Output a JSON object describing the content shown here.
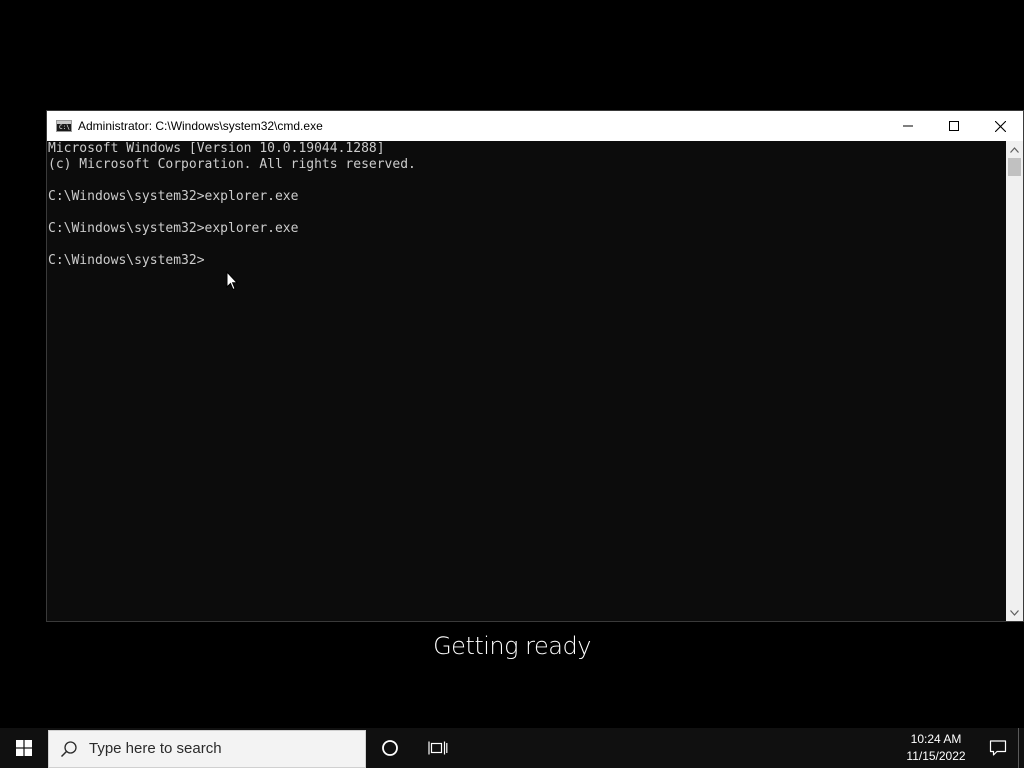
{
  "window": {
    "title": "Administrator: C:\\Windows\\system32\\cmd.exe",
    "icon": "cmd-icon",
    "controls": [
      "minimize-icon",
      "maximize-icon",
      "close-icon"
    ]
  },
  "console": {
    "lines": [
      "Microsoft Windows [Version 10.0.19044.1288]",
      "(c) Microsoft Corporation. All rights reserved.",
      "",
      "C:\\Windows\\system32>explorer.exe",
      "",
      "C:\\Windows\\system32>explorer.exe",
      "",
      "C:\\Windows\\system32>"
    ],
    "text_color": "#cccccc",
    "background": "#0c0c0c"
  },
  "overlay": {
    "status": "Getting ready"
  },
  "taskbar": {
    "start_icon": "windows-logo-icon",
    "search_placeholder": "Type here to search",
    "cortana_icon": "cortana-circle-icon",
    "task_view_icon": "task-view-icon",
    "clock_time": "10:24 AM",
    "clock_date": "11/15/2022",
    "notification_icon": "action-center-icon"
  }
}
